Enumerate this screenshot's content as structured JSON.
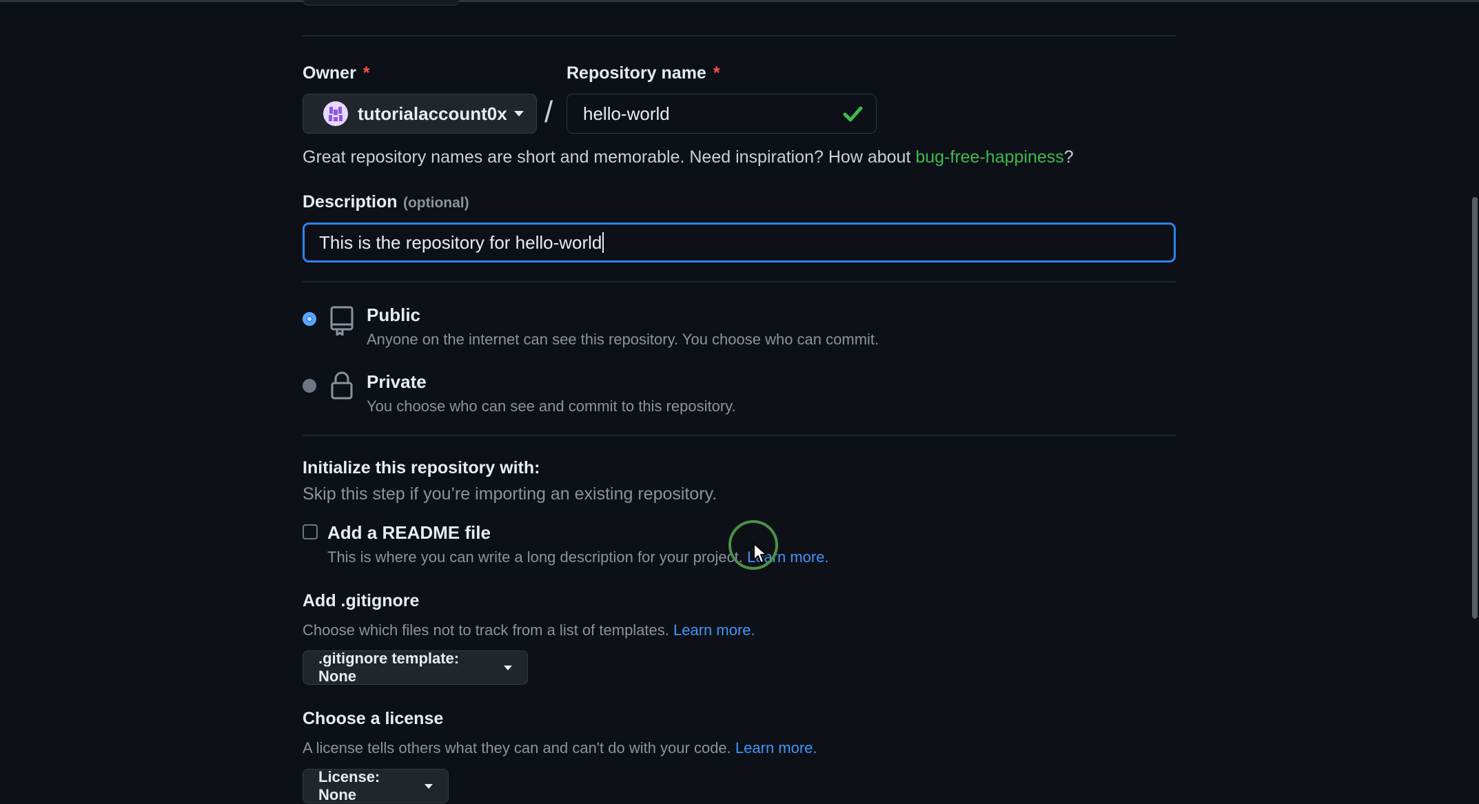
{
  "owner": {
    "label": "Owner",
    "required_mark": "*",
    "value": "tutorialaccount0x"
  },
  "separator": "/",
  "repo_name": {
    "label": "Repository name",
    "required_mark": "*",
    "value": "hello-world",
    "valid_icon": "check-icon"
  },
  "hint": {
    "text": "Great repository names are short and memorable. Need inspiration? How about ",
    "suggestion": "bug-free-happiness",
    "end": "?"
  },
  "description": {
    "label": "Description",
    "optional": "(optional)",
    "value": "This is the repository for hello-world"
  },
  "visibility": {
    "public": {
      "title": "Public",
      "desc": "Anyone on the internet can see this repository. You choose who can commit.",
      "selected": true,
      "icon": "repo-icon"
    },
    "private": {
      "title": "Private",
      "desc": "You choose who can see and commit to this repository.",
      "selected": false,
      "icon": "lock-icon"
    }
  },
  "init": {
    "title": "Initialize this repository with:",
    "subtitle": "Skip this step if you’re importing an existing repository.",
    "readme_label": "Add a README file",
    "readme_desc": "This is where you can write a long description for your project. ",
    "readme_link": "Learn more.",
    "readme_checked": false
  },
  "gitignore": {
    "title": "Add .gitignore",
    "desc": "Choose which files not to track from a list of templates. ",
    "link": "Learn more.",
    "button": ".gitignore template: None"
  },
  "license": {
    "title": "Choose a license",
    "desc": "A license tells others what they can and can't do with your code. ",
    "link": "Learn more.",
    "button": "License: None"
  },
  "colors": {
    "background": "#0d1117",
    "accent_blue": "#2f81f7",
    "success_green": "#3fb950",
    "required_red": "#f85149"
  }
}
